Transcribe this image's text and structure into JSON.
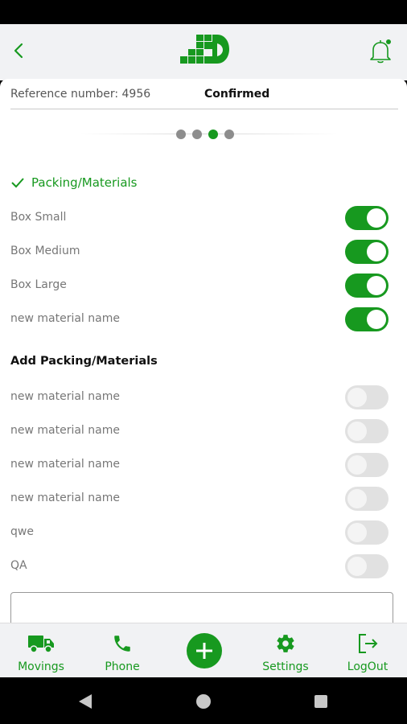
{
  "header": {
    "back_icon": "chevron-left-icon",
    "logo_icon": "app-logo",
    "notification_icon": "bell-icon",
    "accent_color": "#17991f"
  },
  "order": {
    "reference_label": "Reference number: 4956",
    "status": "Confirmed"
  },
  "stepper": {
    "total_steps": 4,
    "active_step": 3
  },
  "packing_section": {
    "title": "Packing/Materials",
    "items": [
      {
        "label": "Box Small",
        "enabled": true
      },
      {
        "label": "Box Medium",
        "enabled": true
      },
      {
        "label": "Box Large",
        "enabled": true
      },
      {
        "label": "new material name",
        "enabled": true
      }
    ]
  },
  "add_section": {
    "title": "Add Packing/Materials",
    "items": [
      {
        "label": "new material name",
        "enabled": false
      },
      {
        "label": "new material name",
        "enabled": false
      },
      {
        "label": "new material name",
        "enabled": false
      },
      {
        "label": "new material name",
        "enabled": false
      },
      {
        "label": "qwe",
        "enabled": false
      },
      {
        "label": "QA",
        "enabled": false
      }
    ]
  },
  "comment_field": {
    "value": ""
  },
  "bottom_nav": {
    "movings": "Movings",
    "phone": "Phone",
    "settings": "Settings",
    "logout": "LogOut"
  }
}
